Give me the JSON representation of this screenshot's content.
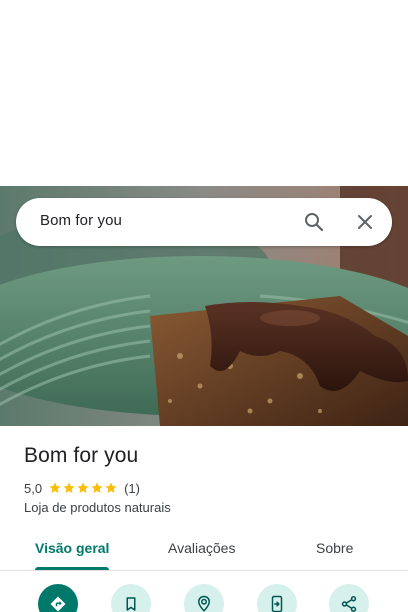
{
  "search": {
    "query": "Bom for you",
    "search_icon": "search-icon",
    "close_icon": "close-icon"
  },
  "hero": {
    "image_subject": "chocolate-topped granola bar on green plate"
  },
  "place": {
    "name": "Bom for you",
    "rating": "5,0",
    "stars": 5,
    "reviews": "(1)",
    "category": "Loja de produtos naturais"
  },
  "tabs": [
    {
      "label": "Visão geral",
      "active": true
    },
    {
      "label": "Avaliações",
      "active": false
    },
    {
      "label": "Sobre",
      "active": false
    }
  ],
  "actions": [
    {
      "icon": "directions-icon",
      "primary": true
    },
    {
      "icon": "bookmark-icon",
      "primary": false
    },
    {
      "icon": "nearby-icon",
      "primary": false
    },
    {
      "icon": "send-to-phone-icon",
      "primary": false
    },
    {
      "icon": "share-icon",
      "primary": false
    }
  ],
  "colors": {
    "accent": "#00796b",
    "action_bg": "#d6f0ec",
    "star": "#fbbc04",
    "text": "#202124",
    "secondary_text": "#3c4043"
  }
}
